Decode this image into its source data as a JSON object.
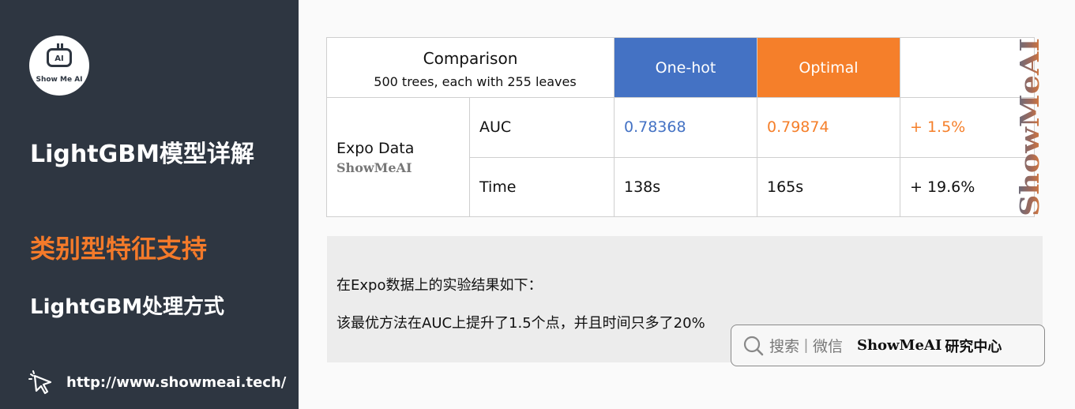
{
  "sidebar": {
    "logo_text": "AI",
    "logo_name": "Show Me AI",
    "title": "LightGBM模型详解",
    "section": "类别型特征支持",
    "subsection": "LightGBM处理方式",
    "url": "http://www.showmeai.tech/"
  },
  "table": {
    "comparison_title": "Comparison",
    "comparison_sub": "500 trees, each with 255 leaves",
    "header_onehot": "One-hot",
    "header_optimal": "Optimal",
    "dataset_label": "Expo Data",
    "dataset_watermark": "ShowMeAI",
    "rows": [
      {
        "metric": "AUC",
        "onehot": "0.78368",
        "optimal": "0.79874",
        "diff": "+ 1.5%"
      },
      {
        "metric": "Time",
        "onehot": "138s",
        "optimal": "165s",
        "diff": "+ 19.6%"
      }
    ],
    "side_watermark": "ShowMeAI"
  },
  "note": {
    "line1": "在Expo数据上的实验结果如下：",
    "line2": "该最优方法在AUC上提升了1.5个点，并且时间只多了20%"
  },
  "badge": {
    "search": "搜索",
    "separator": "|",
    "wechat": "微信",
    "brand": "ShowMeAI",
    "center": "研究中心"
  },
  "colors": {
    "sidebar_bg": "#2e3641",
    "accent_orange": "#f57f2a",
    "accent_blue": "#4472c4"
  }
}
